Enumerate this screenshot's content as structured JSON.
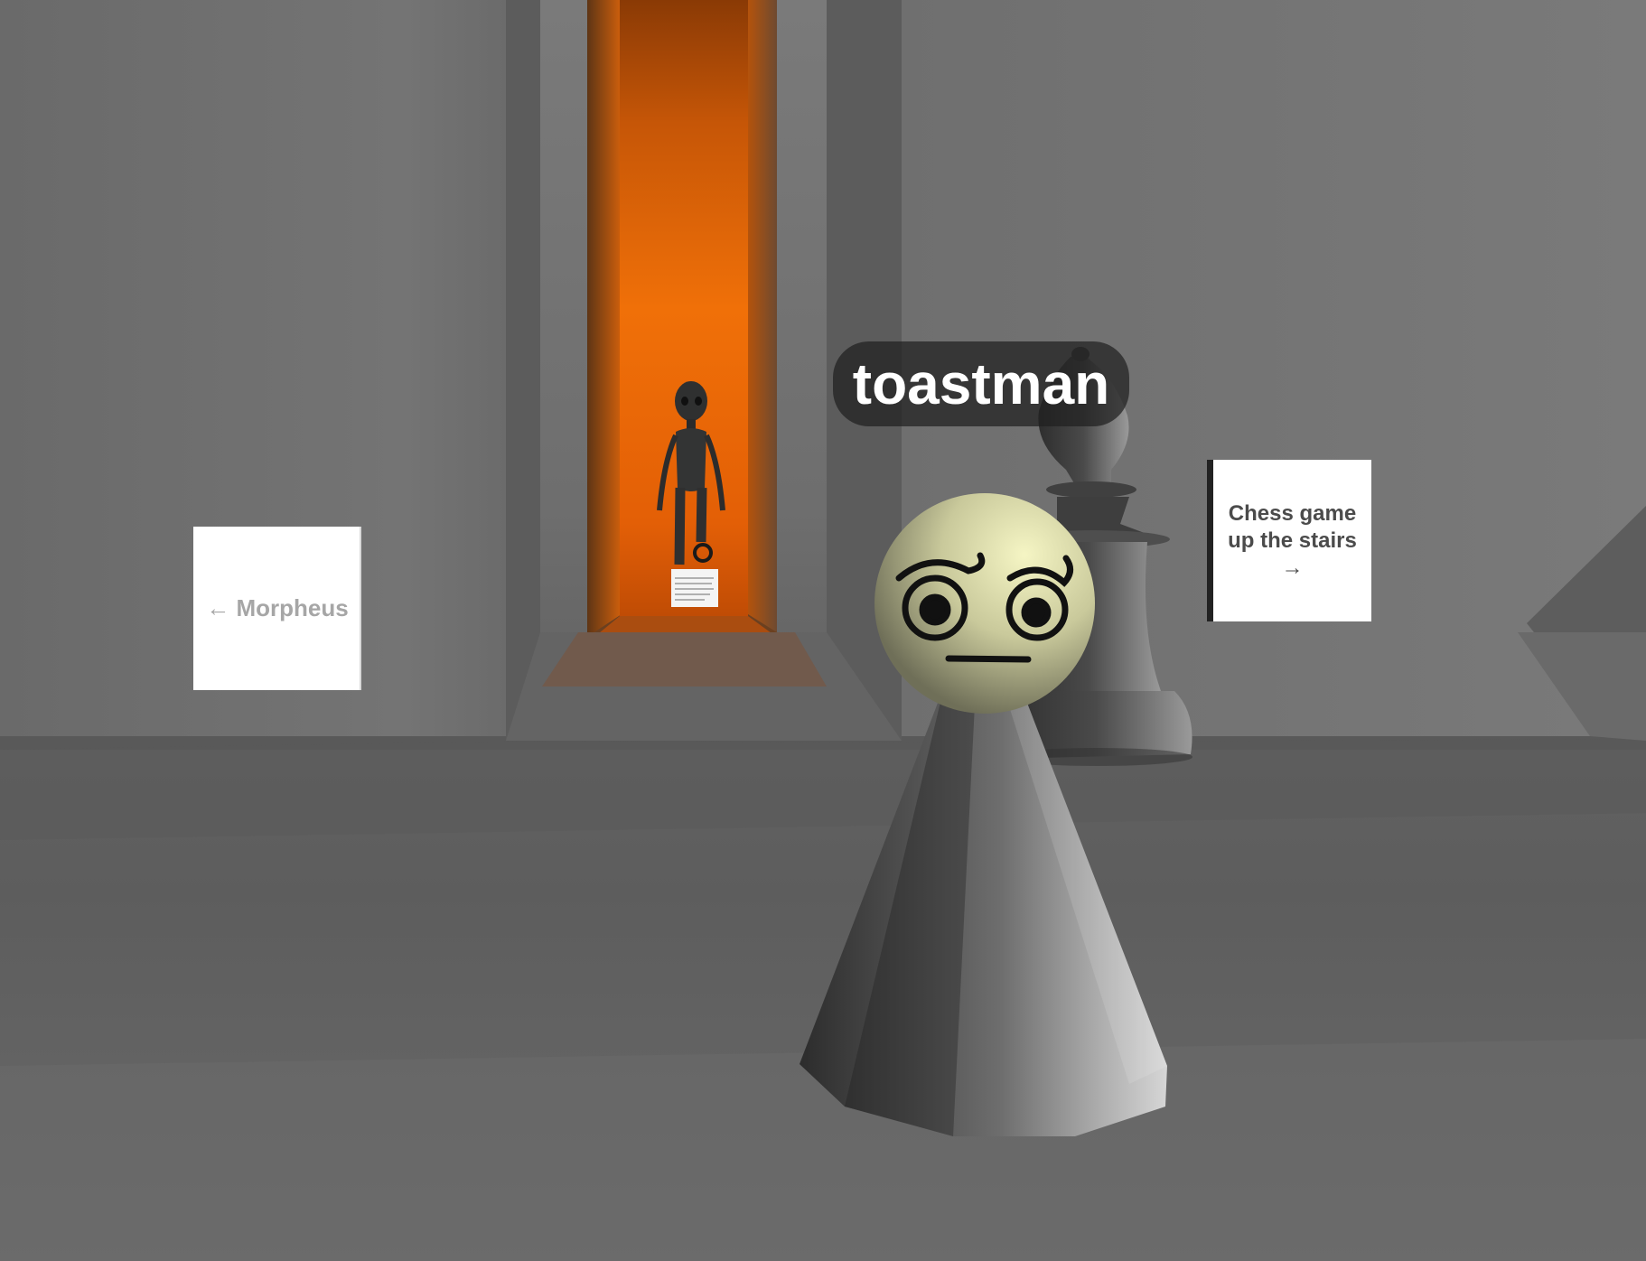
{
  "scene": {
    "player_name": "toastman",
    "sign_left_text": "← Morpheus",
    "sign_right_lines": [
      "Chess game",
      "up the stairs",
      "→"
    ],
    "colors": {
      "wall": "#6d6d6d",
      "floor": "#5e5e5e",
      "corridor_glow": "#e8690a",
      "pawn_head": "#dcdcaa"
    },
    "icons": [
      "meme-face-icon",
      "chess-bishop-icon",
      "alien-statue-icon"
    ]
  }
}
